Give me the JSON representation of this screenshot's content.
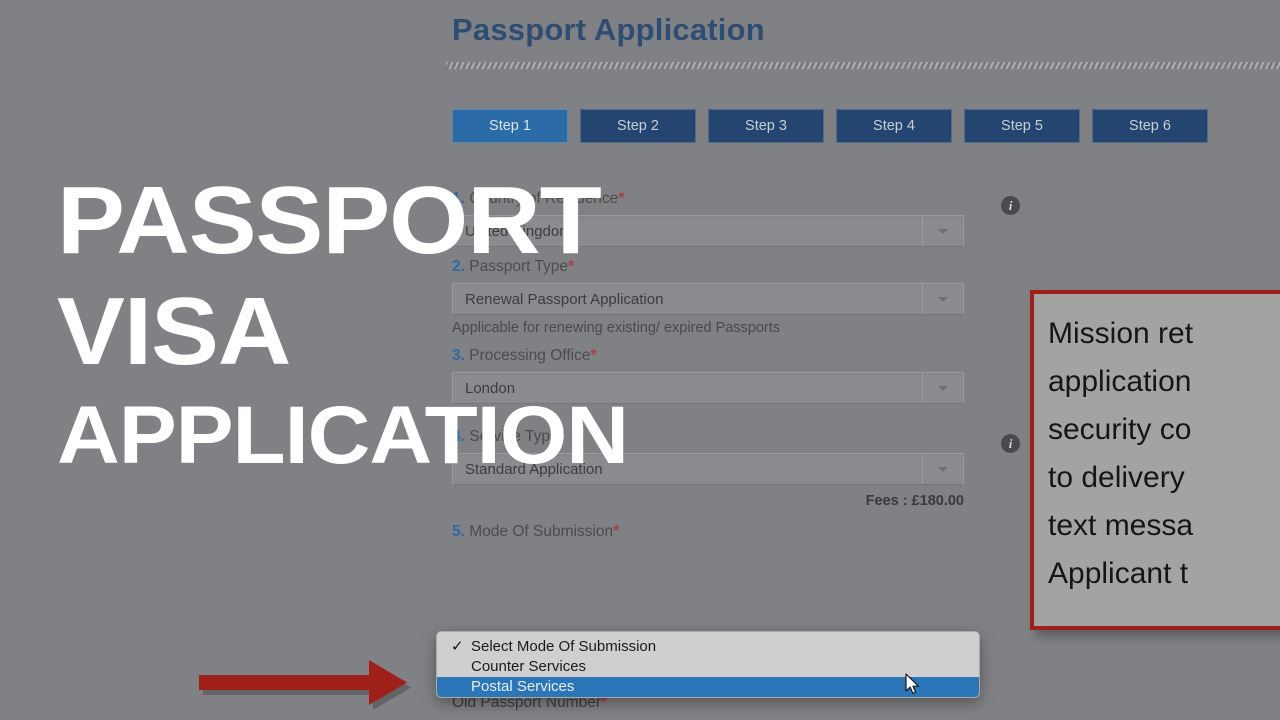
{
  "page": {
    "title": "Passport Application"
  },
  "steps": [
    {
      "label": "Step 1",
      "active": true
    },
    {
      "label": "Step 2",
      "active": false
    },
    {
      "label": "Step 3",
      "active": false
    },
    {
      "label": "Step 4",
      "active": false
    },
    {
      "label": "Step 5",
      "active": false
    },
    {
      "label": "Step 6",
      "active": false
    }
  ],
  "form": {
    "field1": {
      "number": "1.",
      "label": "Country of Residence",
      "required": "*",
      "value": "United Kingdom",
      "info_icon": "info-icon"
    },
    "field2": {
      "number": "2.",
      "label": "Passport Type",
      "required": "*",
      "value": "Renewal Passport Application",
      "hint": "Applicable for renewing existing/ expired Passports"
    },
    "field3": {
      "number": "3.",
      "label": "Processing Office",
      "required": "*",
      "value": "London"
    },
    "field4": {
      "number": "4.",
      "label": "Service Type",
      "required": "*",
      "value": "Standard Application",
      "fees": "Fees : £180.00",
      "info_icon": "info-icon"
    },
    "field5": {
      "number": "5.",
      "label": "Mode Of Submission",
      "required": "*"
    },
    "field6": {
      "label": "Old Passport Number",
      "required": "*"
    }
  },
  "dropdown": {
    "open": true,
    "check_glyph": "✓",
    "options": [
      {
        "label": "Select Mode Of Submission",
        "checked": true,
        "highlighted": false
      },
      {
        "label": "Counter Services",
        "checked": false,
        "highlighted": false
      },
      {
        "label": "Postal Services",
        "checked": false,
        "highlighted": true
      }
    ],
    "highlight_color": "#2a76b8"
  },
  "callout": {
    "lines": [
      "Mission ret",
      "application",
      "security co",
      "to delivery",
      "text messa",
      "Applicant t"
    ],
    "border_color": "#9e2018"
  },
  "arrow": {
    "color": "#9e2018",
    "direction": "right"
  },
  "overlay": {
    "line1": "PASSPORT",
    "line2": "VISA",
    "line3": "APPLICATION",
    "color": "#ffffff"
  }
}
